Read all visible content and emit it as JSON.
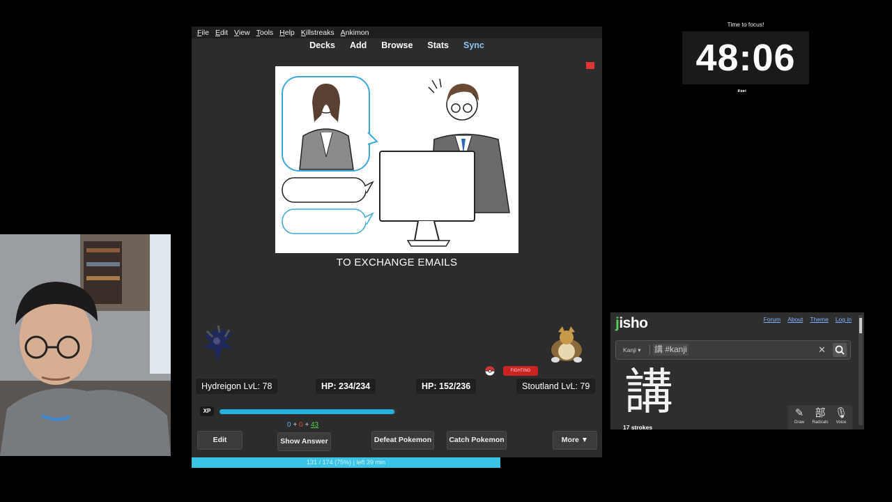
{
  "anki": {
    "menu": [
      "File",
      "Edit",
      "View",
      "Tools",
      "Help",
      "Killstreaks",
      "Ankimon"
    ],
    "toolbar": [
      "Decks",
      "Add",
      "Browse",
      "Stats",
      "Sync"
    ],
    "card_answer": "TO EXCHANGE EMAILS",
    "pokemon_left": {
      "name": "Hydreigon LvL: 78",
      "hp": "HP: 234/234"
    },
    "pokemon_right": {
      "name": "Stoutland LvL: 79",
      "hp": "HP: 152/236",
      "type": "FIGHTING"
    },
    "xp_label": "XP",
    "xp_fraction": 0.99,
    "counts": {
      "new": "0",
      "learn": "0",
      "review": "43",
      "plus": "+"
    },
    "buttons": {
      "edit": "Edit",
      "show_answer": "Show Answer",
      "defeat": "Defeat Pokemon",
      "catch": "Catch Pokemon",
      "more": "More ▼"
    },
    "progress": {
      "text": "131 / 174 (75%) | left 39 min",
      "fraction": 0.75
    }
  },
  "timer": {
    "label": "Time to focus!",
    "time": "48:06",
    "controls": "⏸⏭"
  },
  "jisho": {
    "logo_j": "j",
    "logo_rest": "isho",
    "nav": [
      "Forum",
      "About",
      "Theme",
      "Log in"
    ],
    "search_mode": "Kanji ▾",
    "query": "講 #kanji",
    "clear": "✕",
    "kanji": "講",
    "strokes": "17 strokes",
    "tools": [
      {
        "glyph": "✎",
        "label": "Draw"
      },
      {
        "glyph": "部",
        "label": "Radicals"
      },
      {
        "glyph": "🎙",
        "label": "Voice"
      }
    ]
  },
  "colors": {
    "accent": "#22b3dc",
    "progress": "#39c3e5",
    "jisho_green": "#56d05c",
    "fighting": "#cc2222"
  }
}
